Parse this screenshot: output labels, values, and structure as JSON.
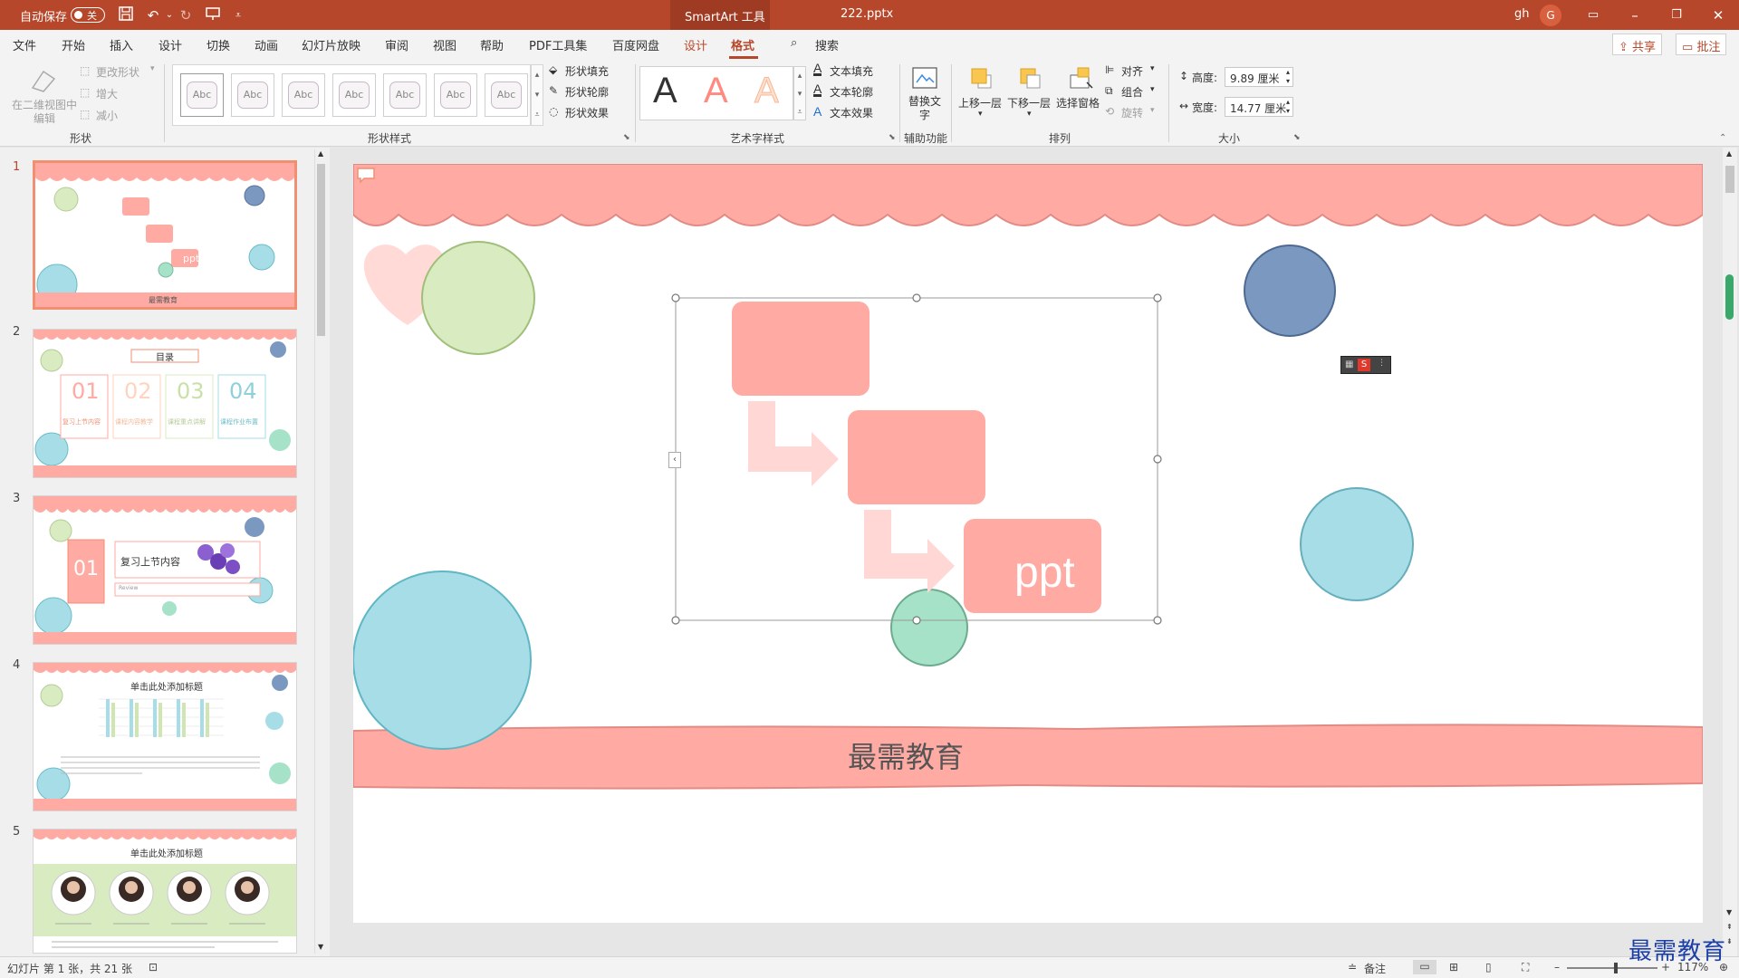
{
  "titlebar": {
    "autosave_label": "自动保存",
    "autosave_state": "关",
    "context_tab": "SmartArt 工具",
    "filename": "222.pptx",
    "user": "gh",
    "avatar_letter": "G",
    "icons": [
      "save-icon",
      "undo-icon",
      "redo-icon",
      "present-icon",
      "customize-icon",
      "ribbon-display-icon",
      "minimize-icon",
      "restore-icon",
      "close-icon"
    ]
  },
  "tabs": [
    "文件",
    "开始",
    "插入",
    "设计",
    "切换",
    "动画",
    "幻灯片放映",
    "审阅",
    "视图",
    "帮助",
    "PDF工具集",
    "百度网盘",
    "设计",
    "格式"
  ],
  "search_label": "搜索",
  "share_label": "共享",
  "comment_label": "批注",
  "ribbon": {
    "shape_group": {
      "label": "形状",
      "edit_2d": "在二维视图中编辑",
      "change_shape": "更改形状",
      "larger": "增大",
      "smaller": "减小"
    },
    "shape_styles": {
      "label": "形状样式",
      "sample": "Abc",
      "fill": "形状填充",
      "outline": "形状轮廓",
      "effect": "形状效果"
    },
    "wordart": {
      "label": "艺术字样式",
      "letter": "A",
      "text_fill": "文本填充",
      "text_outline": "文本轮廓",
      "text_effect": "文本效果"
    },
    "accessibility": {
      "label": "辅助功能",
      "alt_text": "替换文字"
    },
    "arrange": {
      "label": "排列",
      "bring_forward": "上移一层",
      "send_backward": "下移一层",
      "selection_pane": "选择窗格",
      "align": "对齐",
      "group": "组合",
      "rotate": "旋转"
    },
    "size": {
      "label": "大小",
      "height_label": "高度:",
      "height_value": "9.89 厘米",
      "width_label": "宽度:",
      "width_value": "14.77 厘米"
    }
  },
  "slides": [
    {
      "num": "1",
      "footer": "最需教育",
      "box_text": "ppt"
    },
    {
      "num": "2",
      "title": "目录",
      "items": [
        "01",
        "02",
        "03",
        "04"
      ],
      "subs": [
        "复习上节内容",
        "课程内容教学",
        "课程重点讲解",
        "课程作业布置"
      ]
    },
    {
      "num": "3",
      "big": "01",
      "title": "复习上节内容",
      "sub": "Review"
    },
    {
      "num": "4",
      "title": "单击此处添加标题"
    },
    {
      "num": "5",
      "title": "单击此处添加标题"
    }
  ],
  "main_slide": {
    "smartart_text": "ppt",
    "footer_text": "最需教育"
  },
  "statusbar": {
    "slide_info": "幻灯片 第 1 张，共 21 张",
    "notes": "备注",
    "zoom": "117%"
  },
  "watermark": "最需教育",
  "colors": {
    "accent": "#b7472a",
    "salmon": "#ffaaa3",
    "teal": "#a7dde6",
    "navy": "#7b99c0",
    "green": "#d8ebc1",
    "mint": "#a6e2c8"
  }
}
